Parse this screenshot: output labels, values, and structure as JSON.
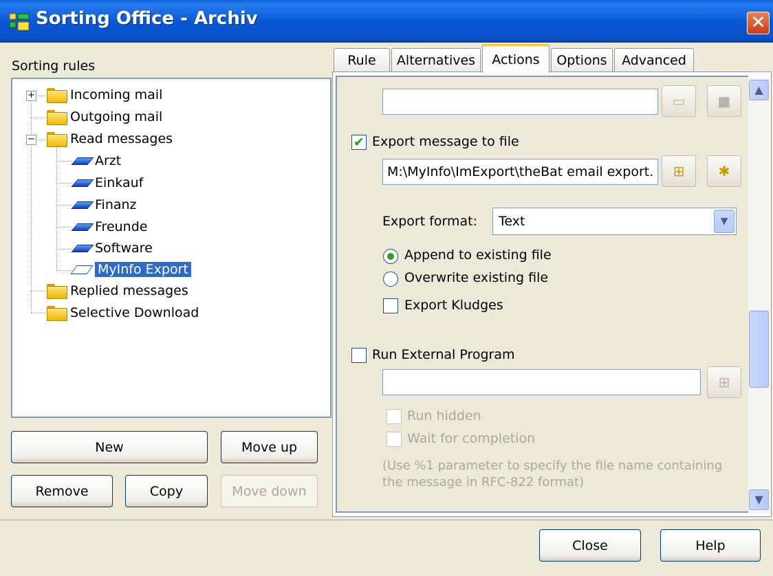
{
  "window": {
    "title": "Sorting Office - Archiv",
    "close_glyph": "✕"
  },
  "left": {
    "label": "Sorting rules",
    "tree": [
      {
        "label": "Incoming mail",
        "icon": "folder-icon",
        "expander": "+"
      },
      {
        "label": "Outgoing mail",
        "icon": "folder-icon"
      },
      {
        "label": "Read messages",
        "icon": "folder-icon",
        "expander": "−"
      },
      {
        "label": "Arzt",
        "icon": "rule-icon"
      },
      {
        "label": "Einkauf",
        "icon": "rule-icon"
      },
      {
        "label": "Finanz",
        "icon": "rule-icon"
      },
      {
        "label": "Freunde",
        "icon": "rule-icon"
      },
      {
        "label": "Software",
        "icon": "rule-icon"
      },
      {
        "label": "MyInfo Export",
        "icon": "rule-open-icon",
        "selected": true
      },
      {
        "label": "Replied messages",
        "icon": "folder-icon"
      },
      {
        "label": "Selective Download",
        "icon": "folder-icon"
      }
    ],
    "buttons": {
      "new": "New",
      "move_up": "Move up",
      "remove": "Remove",
      "copy": "Copy",
      "move_down": "Move down"
    }
  },
  "tabs": [
    "Rule",
    "Alternatives",
    "Actions",
    "Options",
    "Advanced"
  ],
  "active_tab": "Actions",
  "actions": {
    "top_field_value": "",
    "export_to_file": {
      "label": "Export message to file",
      "checked": true,
      "path": "M:\\MyInfo\\ImExport\\theBat email export."
    },
    "export_format": {
      "label": "Export format:",
      "value": "Text"
    },
    "append": {
      "label": "Append to existing file",
      "selected": true
    },
    "overwrite": {
      "label": "Overwrite existing file",
      "selected": false
    },
    "kludges": {
      "label": "Export Kludges",
      "checked": false
    },
    "run_external": {
      "label": "Run External Program",
      "checked": false,
      "value": ""
    },
    "run_hidden": "Run hidden",
    "wait_completion": "Wait for completion",
    "hint_line1": "(Use %1 parameter to specify the file name containing",
    "hint_line2": "the message in RFC-822 format)"
  },
  "footer": {
    "close": "Close",
    "help": "Help"
  }
}
